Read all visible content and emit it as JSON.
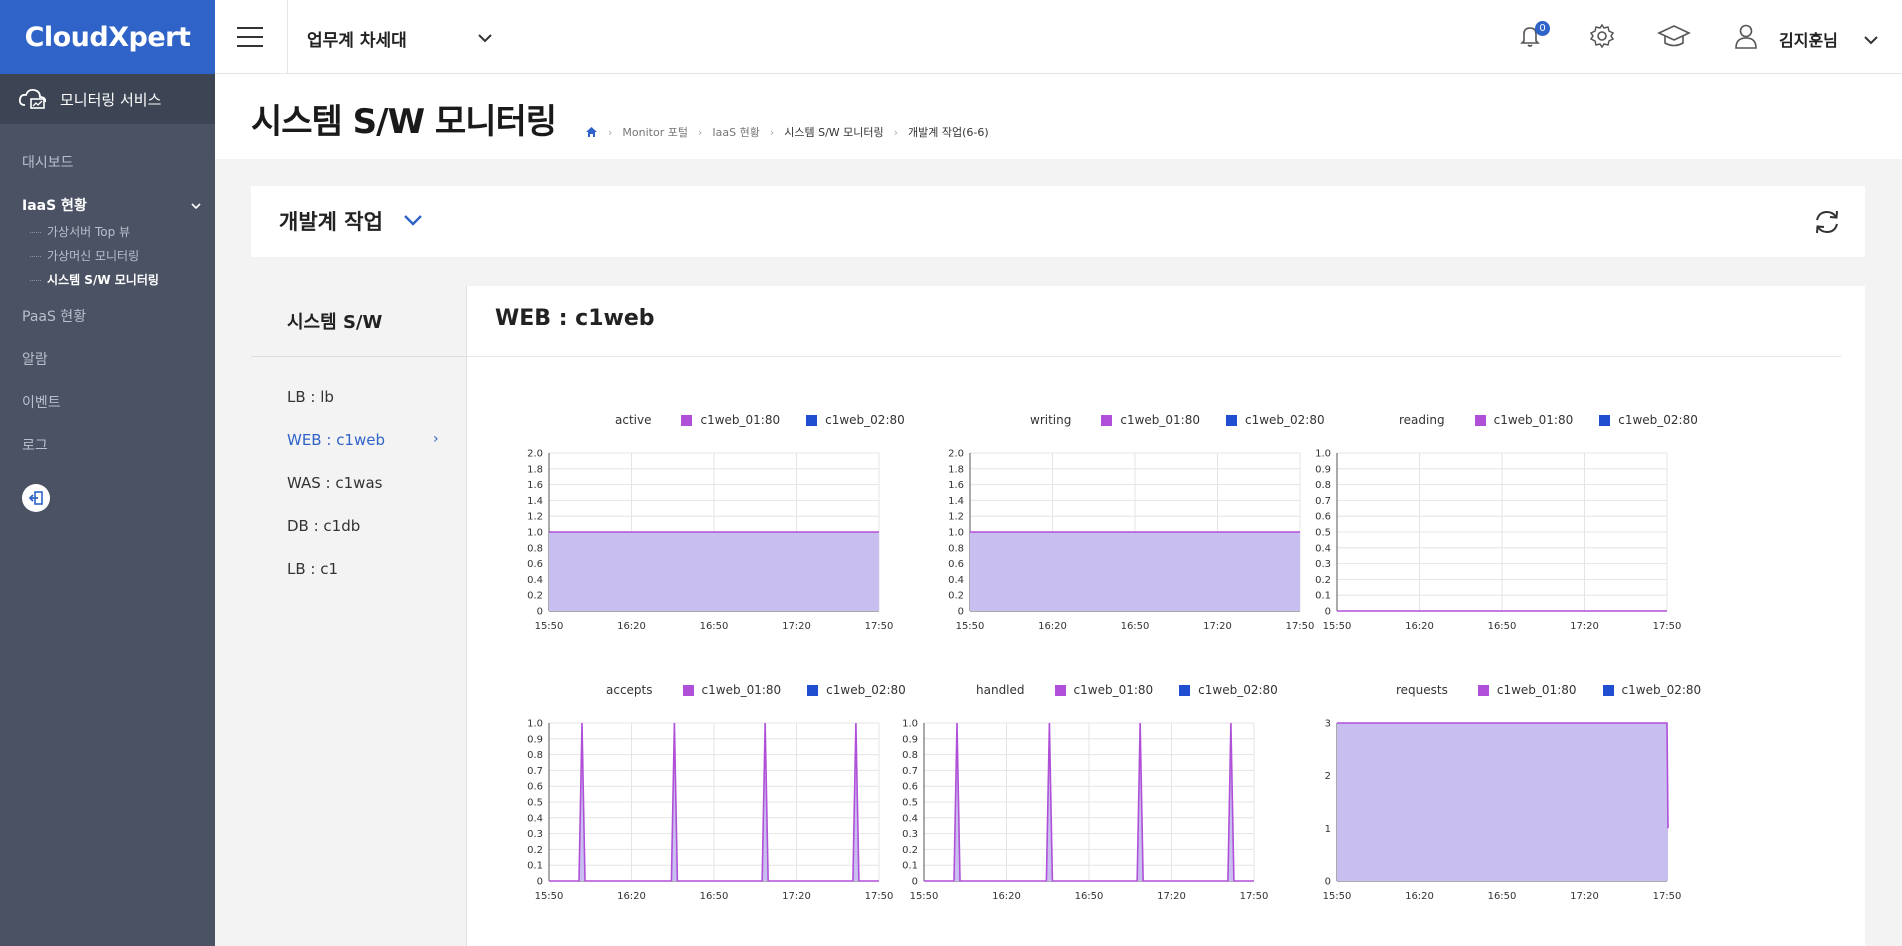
{
  "app": {
    "logo": "CloudXpert",
    "service": "모니터링 서비스"
  },
  "sidebar": {
    "items": [
      {
        "label": "대시보드"
      },
      {
        "label": "IaaS 현황",
        "open": true,
        "children": [
          "가상서버 Top 뷰",
          "가상머신 모니터링",
          "시스템 S/W 모니터링"
        ]
      },
      {
        "label": "PaaS 현황"
      },
      {
        "label": "알람"
      },
      {
        "label": "이벤트"
      },
      {
        "label": "로그"
      }
    ]
  },
  "topbar": {
    "project": "업무계 차세대",
    "notif_count": "0",
    "user": "김지훈님"
  },
  "page": {
    "title": "시스템 S/W 모니터링",
    "breadcrumb": [
      "Monitor 포털",
      "IaaS 현황",
      "시스템 S/W 모니터링",
      "개발계 작업(6-6)"
    ]
  },
  "job": {
    "title": "개발계 작업"
  },
  "list": {
    "title": "시스템 S/W",
    "items": [
      "LB : lb",
      "WEB : c1web",
      "WAS : c1was",
      "DB : c1db",
      "LB : c1"
    ],
    "active_index": 1
  },
  "main": {
    "title": "WEB : c1web"
  },
  "colors": {
    "series1": "#b04fd8",
    "series2": "#1f4fd0",
    "fill": "#c8bff0",
    "accent": "#2f63c8",
    "sidebar": "#4a5263"
  },
  "chart_data": [
    {
      "type": "area",
      "title": "active",
      "x": [
        "15:50",
        "16:20",
        "16:50",
        "17:20",
        "17:50"
      ],
      "ylim": [
        0,
        2.0
      ],
      "yticks": [
        0,
        0.2,
        0.4,
        0.6,
        0.8,
        1.0,
        1.2,
        1.4,
        1.6,
        1.8,
        2.0
      ],
      "ytick_labels": [
        "0",
        "0.2",
        "0.4",
        "0.6",
        "0.8",
        "1.0",
        "1.2",
        "1.4",
        "1.6",
        "1.8",
        "2.0"
      ],
      "series": [
        {
          "name": "c1web_01:80",
          "values": [
            1,
            1,
            1,
            1,
            1
          ]
        },
        {
          "name": "c1web_02:80",
          "values": [
            1,
            1,
            1,
            1,
            1
          ]
        }
      ]
    },
    {
      "type": "area",
      "title": "writing",
      "x": [
        "15:50",
        "16:20",
        "16:50",
        "17:20",
        "17:50"
      ],
      "ylim": [
        0,
        2.0
      ],
      "yticks": [
        0,
        0.2,
        0.4,
        0.6,
        0.8,
        1.0,
        1.2,
        1.4,
        1.6,
        1.8,
        2.0
      ],
      "ytick_labels": [
        "0",
        "0.2",
        "0.4",
        "0.6",
        "0.8",
        "1.0",
        "1.2",
        "1.4",
        "1.6",
        "1.8",
        "2.0"
      ],
      "series": [
        {
          "name": "c1web_01:80",
          "values": [
            1,
            1,
            1,
            1,
            1
          ]
        },
        {
          "name": "c1web_02:80",
          "values": [
            1,
            1,
            1,
            1,
            1
          ]
        }
      ]
    },
    {
      "type": "area",
      "title": "reading",
      "x": [
        "15:50",
        "16:20",
        "16:50",
        "17:20",
        "17:50"
      ],
      "ylim": [
        0,
        1.0
      ],
      "yticks": [
        0,
        0.1,
        0.2,
        0.3,
        0.4,
        0.5,
        0.6,
        0.7,
        0.8,
        0.9,
        1.0
      ],
      "ytick_labels": [
        "0",
        "0.1",
        "0.2",
        "0.3",
        "0.4",
        "0.5",
        "0.6",
        "0.7",
        "0.8",
        "0.9",
        "1.0"
      ],
      "series": [
        {
          "name": "c1web_01:80",
          "values": [
            0,
            0,
            0,
            0,
            0
          ]
        },
        {
          "name": "c1web_02:80",
          "values": [
            0,
            0,
            0,
            0,
            0
          ]
        }
      ]
    },
    {
      "type": "area",
      "title": "accepts",
      "x": [
        "15:50",
        "16:20",
        "16:50",
        "17:20",
        "17:50"
      ],
      "ylim": [
        0,
        1.0
      ],
      "yticks": [
        0,
        0.1,
        0.2,
        0.3,
        0.4,
        0.5,
        0.6,
        0.7,
        0.8,
        0.9,
        1.0
      ],
      "ytick_labels": [
        "0",
        "0.1",
        "0.2",
        "0.3",
        "0.4",
        "0.5",
        "0.6",
        "0.7",
        "0.8",
        "0.9",
        "1.0"
      ],
      "spikes": [
        0.1,
        0.38,
        0.655,
        0.93
      ],
      "series": [
        {
          "name": "c1web_01:80",
          "values": [
            0,
            0,
            0,
            0,
            0
          ]
        },
        {
          "name": "c1web_02:80",
          "values": [
            0,
            0,
            0,
            0,
            0
          ]
        }
      ]
    },
    {
      "type": "area",
      "title": "handled",
      "x": [
        "15:50",
        "16:20",
        "16:50",
        "17:20",
        "17:50"
      ],
      "ylim": [
        0,
        1.0
      ],
      "yticks": [
        0,
        0.1,
        0.2,
        0.3,
        0.4,
        0.5,
        0.6,
        0.7,
        0.8,
        0.9,
        1.0
      ],
      "ytick_labels": [
        "0",
        "0.1",
        "0.2",
        "0.3",
        "0.4",
        "0.5",
        "0.6",
        "0.7",
        "0.8",
        "0.9",
        "1.0"
      ],
      "spikes": [
        0.1,
        0.38,
        0.655,
        0.93
      ],
      "series": [
        {
          "name": "c1web_01:80",
          "values": [
            0,
            0,
            0,
            0,
            0
          ]
        },
        {
          "name": "c1web_02:80",
          "values": [
            0,
            0,
            0,
            0,
            0
          ]
        }
      ]
    },
    {
      "type": "area",
      "title": "requests",
      "x": [
        "15:50",
        "16:20",
        "16:50",
        "17:20",
        "17:50"
      ],
      "ylim": [
        0,
        3
      ],
      "yticks": [
        0,
        1,
        2,
        3
      ],
      "ytick_labels": [
        "0",
        "1",
        "2",
        "3"
      ],
      "end_value": 1,
      "series": [
        {
          "name": "c1web_01:80",
          "values": [
            3,
            3,
            3,
            3,
            3
          ]
        },
        {
          "name": "c1web_02:80",
          "values": [
            3,
            3,
            3,
            3,
            3
          ]
        }
      ]
    }
  ]
}
